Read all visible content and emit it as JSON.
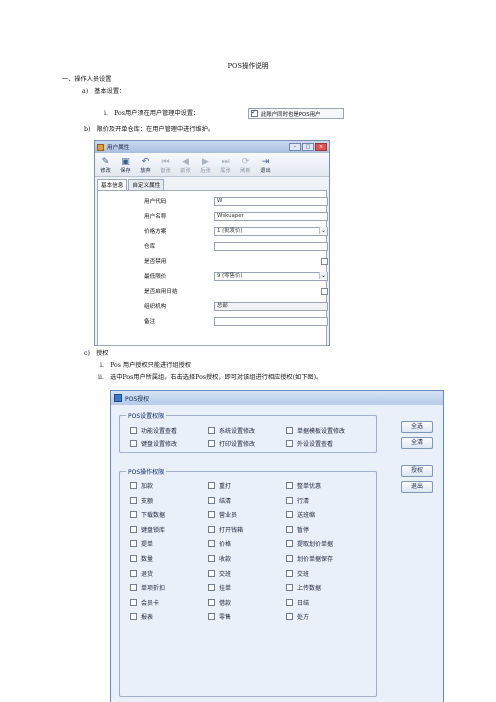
{
  "doc": {
    "title": "POS操作说明",
    "section1": "一、操作人员设置",
    "item_a": "a)　基本设置：",
    "item_a_i": "i.　Pos用户须在用户管理中设置：",
    "item_b": "b)　限价及开单仓库：在用户管理中进行维护。",
    "item_c": "c)　授权",
    "item_c_i": "i.　Pos 用户授权只能进行组授权",
    "item_c_ii": "ii.　选中Pos用户所属组，右击选择Pos授权，即可对该组进行相应授权(如下图)。"
  },
  "inline_checkbox": {
    "label": "此账户同时也是POS用户",
    "checked": true
  },
  "user_window": {
    "title": "用户属性",
    "toolbar": [
      {
        "label": "修改",
        "icon": "edit-icon",
        "enabled": true
      },
      {
        "label": "保存",
        "icon": "save-icon",
        "enabled": true
      },
      {
        "label": "放弃",
        "icon": "undo-icon",
        "enabled": true
      },
      {
        "label": "首张",
        "icon": "first-icon",
        "enabled": false
      },
      {
        "label": "前张",
        "icon": "prev-icon",
        "enabled": false
      },
      {
        "label": "后张",
        "icon": "next-icon",
        "enabled": false
      },
      {
        "label": "尾张",
        "icon": "last-icon",
        "enabled": false
      },
      {
        "label": "刷新",
        "icon": "refresh-icon",
        "enabled": false
      },
      {
        "label": "退出",
        "icon": "exit-icon",
        "enabled": true
      }
    ],
    "tabs": [
      "基本信息",
      "自定义属性"
    ],
    "fields": {
      "code": {
        "label": "用户代码",
        "value": "W"
      },
      "name": {
        "label": "用户名称",
        "value": "Wskuaper"
      },
      "price_plan": {
        "label": "价格方案",
        "value": "1 (批发价)"
      },
      "warehouse": {
        "label": "仓库",
        "value": ""
      },
      "disabled": {
        "label": "是否禁用"
      },
      "min_price": {
        "label": "最低限价",
        "value": "9 (零售价)"
      },
      "daily_close": {
        "label": "是否启用日结"
      },
      "org": {
        "label": "组织机构",
        "value": "总部"
      },
      "note": {
        "label": "备注",
        "value": ""
      }
    }
  },
  "pos_window": {
    "title": "POS授权",
    "group1_title": "POS设置权限",
    "group1": [
      "功能设置查看",
      "系统设置修改",
      "单据模板设置修改",
      "键盘设置修改",
      "打印设置修改",
      "外设设置查看"
    ],
    "group2_title": "POS操作权限",
    "group2": [
      "加款",
      "重打",
      "整单优惠",
      "支额",
      "结清",
      "行清",
      "下载数据",
      "营业员",
      "送班缩",
      "键盘锁库",
      "打开钱箱",
      "暂停",
      "提单",
      "价格",
      "提取划价单据",
      "数量",
      "收款",
      "划价单据保存",
      "退货",
      "交班",
      "交班",
      "单项折扣",
      "挂单",
      "上传数据",
      "会员卡",
      "借款",
      "日结",
      "报表",
      "零售",
      "处方"
    ],
    "buttons": [
      "全选",
      "全清",
      "授权",
      "退出"
    ]
  }
}
